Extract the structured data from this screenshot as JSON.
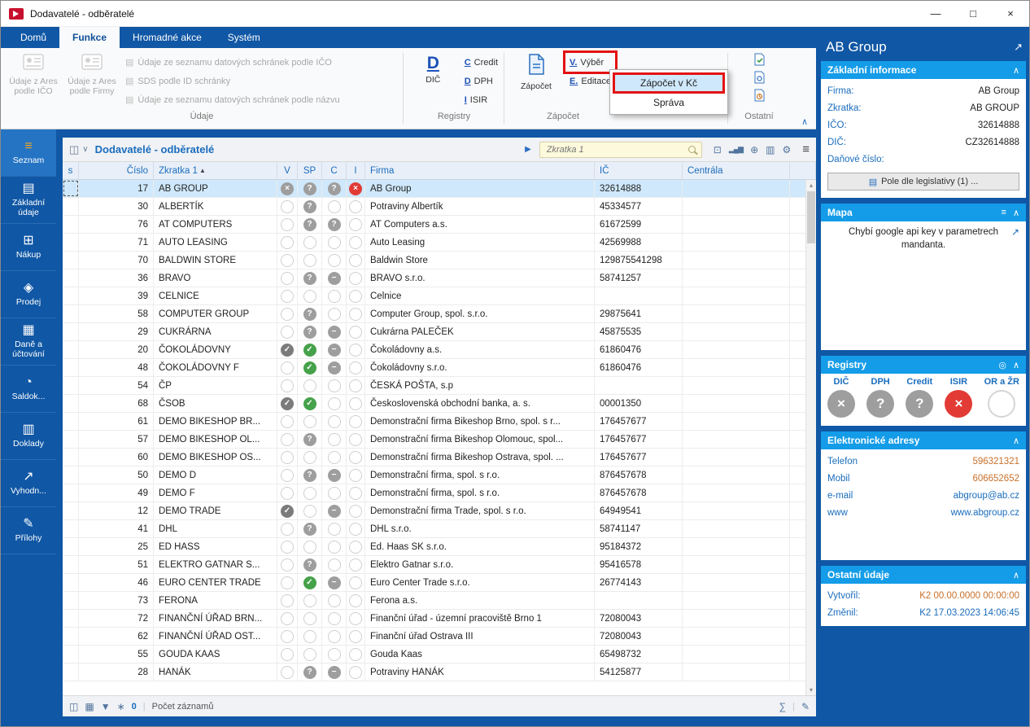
{
  "colors": {
    "accent_blue": "#1057a5",
    "section_header_blue": "#149ce8",
    "annotation_red": "#e31212",
    "selection_blue": "#cfe8fb",
    "active_icon_orange": "#f5a623"
  },
  "window": {
    "title": "Dodavatelé - odběratelé",
    "controls": {
      "minimize": "—",
      "maximize": "□",
      "close": "×"
    }
  },
  "ribbon": {
    "tabs": [
      {
        "label": "Domů",
        "active": false
      },
      {
        "label": "Funkce",
        "active": true
      },
      {
        "label": "Hromadné akce",
        "active": false
      },
      {
        "label": "Systém",
        "active": false
      }
    ],
    "udaje": {
      "group_label": "Údaje",
      "big_buttons": [
        "Údaje z Ares podle IČO",
        "Údaje z Ares podle Firmy"
      ],
      "rows": [
        "Údaje ze seznamu datových schránek podle IČO",
        "SDS podle ID schránky",
        "Údaje ze seznamu datových schránek podle názvu"
      ]
    },
    "registry": {
      "group_label": "Registry",
      "big": {
        "key": "D",
        "label": "DIČ"
      },
      "rows": [
        {
          "key": "C",
          "label": "Credit"
        },
        {
          "key": "D",
          "label": "DPH"
        },
        {
          "key": "I",
          "label": "ISIR"
        }
      ]
    },
    "zapocet": {
      "group_label": "Zápočet",
      "big_label": "Zápočet",
      "rows": [
        {
          "key": "V.",
          "label": "Výběr",
          "annotated": true
        },
        {
          "key": "E.",
          "label": "Editace",
          "annotated": false
        }
      ]
    },
    "ostatni": {
      "group_label": "Ostatní"
    },
    "menu": {
      "items": [
        {
          "label": "Zápočet v Kč",
          "highlighted": true
        },
        {
          "label": "Správa",
          "highlighted": false
        }
      ]
    }
  },
  "sidebar": {
    "items": [
      {
        "label": "Seznam",
        "icon": "menu",
        "active": true
      },
      {
        "label": "Základní údaje",
        "icon": "details",
        "active": false
      },
      {
        "label": "Nákup",
        "icon": "purchase",
        "active": false
      },
      {
        "label": "Prodej",
        "icon": "sale",
        "active": false
      },
      {
        "label": "Daně a účtování",
        "icon": "taxes",
        "active": false
      },
      {
        "label": "Saldok...",
        "icon": "saldo",
        "active": false
      },
      {
        "label": "Doklady",
        "icon": "documents",
        "active": false
      },
      {
        "label": "Vyhodn...",
        "icon": "evaluation",
        "active": false
      },
      {
        "label": "Přílohy",
        "icon": "attachments",
        "active": false
      }
    ]
  },
  "table": {
    "title": "Dodavatelé - odběratelé",
    "search_placeholder": "Zkratka 1",
    "columns": [
      "s",
      "Číslo",
      "Zkratka 1",
      "V",
      "SP",
      "C",
      "I",
      "Firma",
      "IČ",
      "Centrála"
    ],
    "rows": [
      {
        "cislo": "17",
        "zkratka": "AB GROUP",
        "v": "gray-x",
        "sp": "gray-q",
        "c": "gray-q",
        "i": "red-x",
        "firma": "AB Group",
        "ic": "32614888",
        "centrala": "",
        "selected": true
      },
      {
        "cislo": "30",
        "zkratka": "ALBERTÍK",
        "v": "empty",
        "sp": "gray-q",
        "c": "empty",
        "i": "empty",
        "firma": "Potraviny Albertík",
        "ic": "45334577",
        "centrala": ""
      },
      {
        "cislo": "76",
        "zkratka": "AT COMPUTERS",
        "v": "empty",
        "sp": "gray-q",
        "c": "gray-q",
        "i": "empty",
        "firma": "AT Computers a.s.",
        "ic": "61672599",
        "centrala": ""
      },
      {
        "cislo": "71",
        "zkratka": "AUTO LEASING",
        "v": "empty",
        "sp": "empty",
        "c": "empty",
        "i": "empty",
        "firma": "Auto Leasing",
        "ic": "42569988",
        "centrala": ""
      },
      {
        "cislo": "70",
        "zkratka": "BALDWIN STORE",
        "v": "empty",
        "sp": "empty",
        "c": "empty",
        "i": "empty",
        "firma": "Baldwin Store",
        "ic": "129875541298",
        "centrala": ""
      },
      {
        "cislo": "36",
        "zkratka": "BRAVO",
        "v": "empty",
        "sp": "gray-q",
        "c": "gray-minus",
        "i": "empty",
        "firma": "BRAVO s.r.o.",
        "ic": "58741257",
        "centrala": ""
      },
      {
        "cislo": "39",
        "zkratka": "CELNICE",
        "v": "empty",
        "sp": "empty",
        "c": "empty",
        "i": "empty",
        "firma": "Celnice",
        "ic": "",
        "centrala": ""
      },
      {
        "cislo": "58",
        "zkratka": "COMPUTER GROUP",
        "v": "empty",
        "sp": "gray-q",
        "c": "empty",
        "i": "empty",
        "firma": "Computer Group, spol. s.r.o.",
        "ic": "29875641",
        "centrala": ""
      },
      {
        "cislo": "29",
        "zkratka": "CUKRÁRNA",
        "v": "empty",
        "sp": "gray-q",
        "c": "gray-minus",
        "i": "empty",
        "firma": "Cukrárna PALEČEK",
        "ic": "45875535",
        "centrala": ""
      },
      {
        "cislo": "20",
        "zkratka": "ČOKOLÁDOVNY",
        "v": "gray-check",
        "sp": "green-check",
        "c": "gray-minus",
        "i": "empty",
        "firma": "Čokoládovny a.s.",
        "ic": "61860476",
        "centrala": ""
      },
      {
        "cislo": "48",
        "zkratka": "ČOKOLÁDOVNY F",
        "v": "empty",
        "sp": "green-check",
        "c": "gray-minus",
        "i": "empty",
        "firma": "Čokoládovny s.r.o.",
        "ic": "61860476",
        "centrala": ""
      },
      {
        "cislo": "54",
        "zkratka": "ČP",
        "v": "empty",
        "sp": "empty",
        "c": "empty",
        "i": "empty",
        "firma": "ČESKÁ POŠTA, s.p",
        "ic": "",
        "centrala": ""
      },
      {
        "cislo": "68",
        "zkratka": "ČSOB",
        "v": "gray-check",
        "sp": "green-check",
        "c": "empty",
        "i": "empty",
        "firma": "Československá obchodní banka, a. s.",
        "ic": "00001350",
        "centrala": ""
      },
      {
        "cislo": "61",
        "zkratka": "DEMO BIKESHOP BR...",
        "v": "empty",
        "sp": "empty",
        "c": "empty",
        "i": "empty",
        "firma": "Demonstrační firma Bikeshop Brno, spol. s r...",
        "ic": "176457677",
        "centrala": ""
      },
      {
        "cislo": "57",
        "zkratka": "DEMO BIKESHOP OL...",
        "v": "empty",
        "sp": "gray-q",
        "c": "empty",
        "i": "empty",
        "firma": "Demonstrační firma Bikeshop Olomouc, spol...",
        "ic": "176457677",
        "centrala": ""
      },
      {
        "cislo": "60",
        "zkratka": "DEMO BIKESHOP OS...",
        "v": "empty",
        "sp": "empty",
        "c": "empty",
        "i": "empty",
        "firma": "Demonstrační firma Bikeshop Ostrava, spol. ...",
        "ic": "176457677",
        "centrala": ""
      },
      {
        "cislo": "50",
        "zkratka": "DEMO D",
        "v": "empty",
        "sp": "gray-q",
        "c": "gray-minus",
        "i": "empty",
        "firma": "Demonstrační firma, spol. s r.o.",
        "ic": "876457678",
        "centrala": ""
      },
      {
        "cislo": "49",
        "zkratka": "DEMO F",
        "v": "empty",
        "sp": "empty",
        "c": "empty",
        "i": "empty",
        "firma": "Demonstrační firma, spol. s r.o.",
        "ic": "876457678",
        "centrala": ""
      },
      {
        "cislo": "12",
        "zkratka": "DEMO TRADE",
        "v": "gray-check",
        "sp": "empty",
        "c": "gray-minus",
        "i": "empty",
        "firma": "Demonstrační firma Trade, spol. s r.o.",
        "ic": "64949541",
        "centrala": ""
      },
      {
        "cislo": "41",
        "zkratka": "DHL",
        "v": "empty",
        "sp": "gray-q",
        "c": "empty",
        "i": "empty",
        "firma": "DHL s.r.o.",
        "ic": "58741147",
        "centrala": ""
      },
      {
        "cislo": "25",
        "zkratka": "ED HASS",
        "v": "empty",
        "sp": "empty",
        "c": "empty",
        "i": "empty",
        "firma": "Ed. Haas SK s.r.o.",
        "ic": "95184372",
        "centrala": ""
      },
      {
        "cislo": "51",
        "zkratka": "ELEKTRO GATNAR S...",
        "v": "empty",
        "sp": "gray-q",
        "c": "empty",
        "i": "empty",
        "firma": "Elektro Gatnar s.r.o.",
        "ic": "95416578",
        "centrala": ""
      },
      {
        "cislo": "46",
        "zkratka": "EURO CENTER TRADE",
        "v": "empty",
        "sp": "green-check",
        "c": "gray-minus",
        "i": "empty",
        "firma": "Euro Center Trade s.r.o.",
        "ic": "26774143",
        "centrala": ""
      },
      {
        "cislo": "73",
        "zkratka": "FERONA",
        "v": "empty",
        "sp": "empty",
        "c": "empty",
        "i": "empty",
        "firma": "Ferona a.s.",
        "ic": "",
        "centrala": ""
      },
      {
        "cislo": "72",
        "zkratka": "FINANČNÍ ÚŘAD BRN...",
        "v": "empty",
        "sp": "empty",
        "c": "empty",
        "i": "empty",
        "firma": "Finanční úřad - územní pracoviště Brno 1",
        "ic": "72080043",
        "centrala": ""
      },
      {
        "cislo": "62",
        "zkratka": "FINANČNÍ ÚŘAD OST...",
        "v": "empty",
        "sp": "empty",
        "c": "empty",
        "i": "empty",
        "firma": "Finanční úřad Ostrava III",
        "ic": "72080043",
        "centrala": ""
      },
      {
        "cislo": "55",
        "zkratka": "GOUDA KAAS",
        "v": "empty",
        "sp": "empty",
        "c": "empty",
        "i": "empty",
        "firma": "Gouda Kaas",
        "ic": "65498732",
        "centrala": ""
      },
      {
        "cislo": "28",
        "zkratka": "HANÁK",
        "v": "empty",
        "sp": "gray-q",
        "c": "gray-minus",
        "i": "empty",
        "firma": "Potraviny HANÁK",
        "ic": "54125877",
        "centrala": ""
      }
    ]
  },
  "footer": {
    "count_value": "0",
    "count_label": "Počet záznamů"
  },
  "panel": {
    "title": "AB Group",
    "zakladni": {
      "header": "Základní informace",
      "fields": [
        {
          "label": "Firma:",
          "value": "AB Group"
        },
        {
          "label": "Zkratka:",
          "value": "AB GROUP"
        },
        {
          "label": "IČO:",
          "value": "32614888"
        },
        {
          "label": "DIČ:",
          "value": "CZ32614888"
        },
        {
          "label": "Daňové číslo:",
          "value": ""
        }
      ],
      "button": "Pole dle legislativy (1) ..."
    },
    "mapa": {
      "header": "Mapa",
      "message": "Chybí google api key v parametrech mandanta."
    },
    "registry": {
      "header": "Registry",
      "items": [
        {
          "label": "DIČ",
          "status": "gray-x"
        },
        {
          "label": "DPH",
          "status": "gray-q"
        },
        {
          "label": "Credit",
          "status": "gray-q"
        },
        {
          "label": "ISIR",
          "status": "red-x"
        },
        {
          "label": "OR a ŽR",
          "status": "empty"
        }
      ]
    },
    "adresy": {
      "header": "Elektronické adresy",
      "fields": [
        {
          "label": "Telefon",
          "value": "596321321",
          "value_color": "#c8702a"
        },
        {
          "label": "Mobil",
          "value": "606652652",
          "value_color": "#c8702a"
        },
        {
          "label": "e-mail",
          "value": "abgroup@ab.cz",
          "value_color": "#1a6dbd"
        },
        {
          "label": "www",
          "value": "www.abgroup.cz",
          "value_color": "#1a6dbd"
        }
      ]
    },
    "ostatni": {
      "header": "Ostatní údaje",
      "fields": [
        {
          "label": "Vytvořil:",
          "value": "K2 00.00.0000 00:00:00",
          "value_color": "#c8702a"
        },
        {
          "label": "Změnil:",
          "value": "K2 17.03.2023 14:06:45",
          "value_color": "#1a6dbd"
        }
      ]
    }
  }
}
